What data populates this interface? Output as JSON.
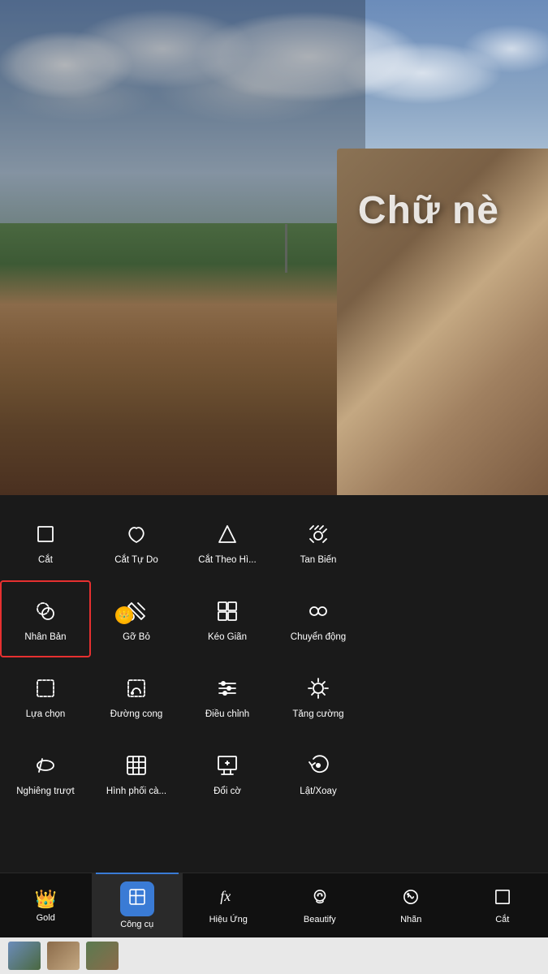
{
  "photo": {
    "overlay_text": "Chữ nè"
  },
  "tools": {
    "rows": [
      [
        {
          "id": "cat",
          "label": "Cắt",
          "selected": false
        },
        {
          "id": "cat-tu-do",
          "label": "Cắt Tự Do",
          "selected": false
        },
        {
          "id": "cat-theo-hi",
          "label": "Cắt Theo Hì...",
          "selected": false
        },
        {
          "id": "tan-bien",
          "label": "Tan Biến",
          "selected": false
        }
      ],
      [
        {
          "id": "nhan-ban",
          "label": "Nhân Bản",
          "selected": true
        },
        {
          "id": "go-bo",
          "label": "Gỡ Bỏ",
          "selected": false,
          "gold": true
        },
        {
          "id": "keo-gian",
          "label": "Kéo Giãn",
          "selected": false
        },
        {
          "id": "chuyen-dong",
          "label": "Chuyển động",
          "selected": false
        }
      ],
      [
        {
          "id": "lua-chon",
          "label": "Lựa chọn",
          "selected": false
        },
        {
          "id": "duong-cong",
          "label": "Đường cong",
          "selected": false
        },
        {
          "id": "dieu-chinh",
          "label": "Điều chỉnh",
          "selected": false
        },
        {
          "id": "tang-cuong",
          "label": "Tăng cường",
          "selected": false
        }
      ],
      [
        {
          "id": "nghieng-truot",
          "label": "Nghiêng trượt",
          "selected": false
        },
        {
          "id": "hinh-phoi-ca",
          "label": "Hình phối cà...",
          "selected": false
        },
        {
          "id": "doi-co",
          "label": "Đổi cờ",
          "selected": false
        },
        {
          "id": "lat-xoay",
          "label": "Lật/Xoay",
          "selected": false
        }
      ]
    ]
  },
  "nav": {
    "items": [
      {
        "id": "gold",
        "label": "Gold"
      },
      {
        "id": "cong-cu",
        "label": "Công cụ",
        "active": true
      },
      {
        "id": "hieu-ung",
        "label": "Hiệu Ứng"
      },
      {
        "id": "beautify",
        "label": "Beautify"
      },
      {
        "id": "nhan",
        "label": "Nhãn"
      },
      {
        "id": "cat",
        "label": "Cắt"
      }
    ]
  }
}
